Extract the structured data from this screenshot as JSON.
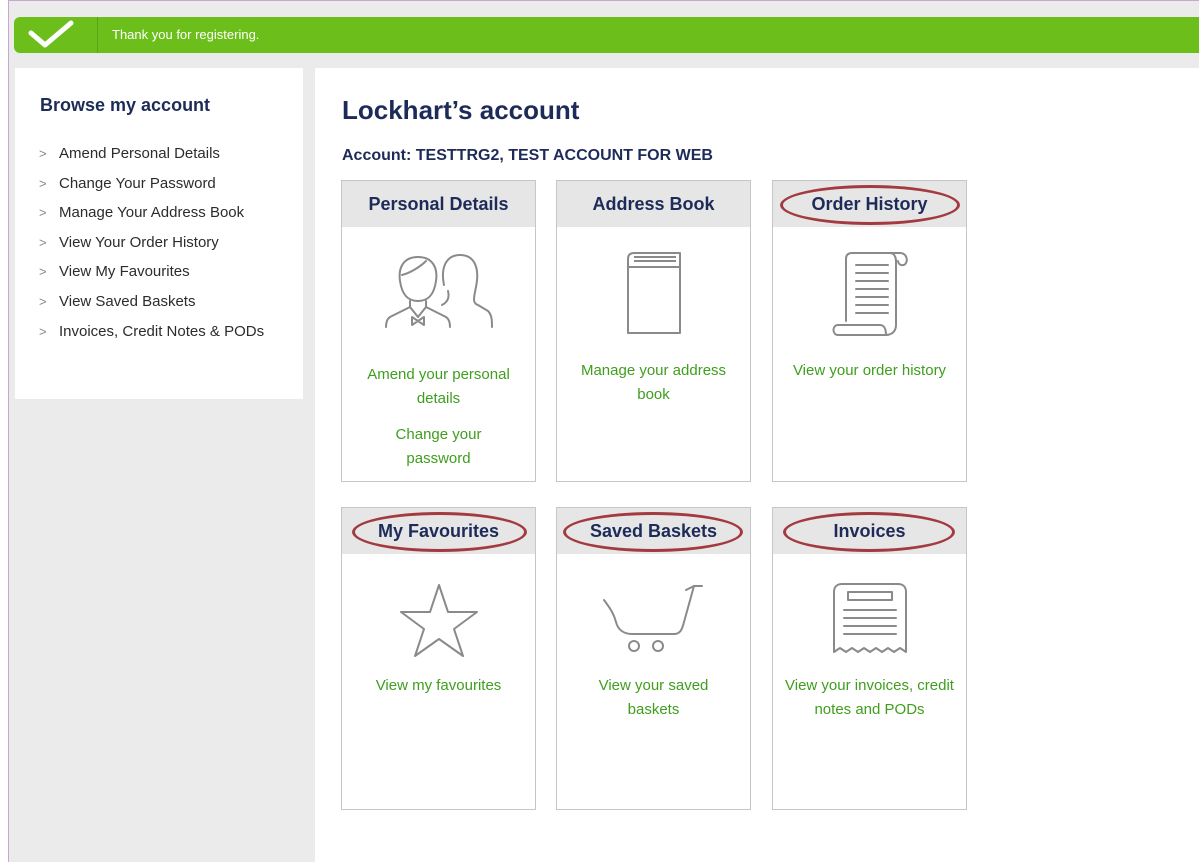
{
  "banner": {
    "message": "Thank you for registering."
  },
  "sidebar": {
    "title": "Browse my account",
    "items": [
      {
        "label": "Amend Personal Details"
      },
      {
        "label": "Change Your Password"
      },
      {
        "label": "Manage Your Address Book"
      },
      {
        "label": "View Your Order History"
      },
      {
        "label": "View My Favourites"
      },
      {
        "label": "View Saved Baskets"
      },
      {
        "label": "Invoices, Credit Notes & PODs"
      }
    ]
  },
  "main": {
    "title": "Lockhart’s account",
    "account": "Account: TESTTRG2, TEST ACCOUNT FOR WEB",
    "cards": {
      "personal": {
        "title": "Personal Details",
        "icon": "people-icon",
        "link1": "Amend your personal details",
        "link2": "Change your password"
      },
      "address": {
        "title": "Address Book",
        "icon": "book-icon",
        "link1": "Manage your address book"
      },
      "orders": {
        "title": "Order History",
        "icon": "scroll-icon",
        "link1": "View your order history"
      },
      "favourites": {
        "title": "My Favourites",
        "icon": "star-icon",
        "link1": "View my favourites"
      },
      "baskets": {
        "title": "Saved Baskets",
        "icon": "cart-icon",
        "link1": "View your saved baskets"
      },
      "invoices": {
        "title": "Invoices",
        "icon": "receipt-icon",
        "link1": "View your invoices, credit notes and PODs"
      }
    }
  },
  "colors": {
    "banner": "#6cbf1a",
    "heading": "#1d2b58",
    "link": "#3f9e1d",
    "highlight_ring": "#a23a3f"
  }
}
